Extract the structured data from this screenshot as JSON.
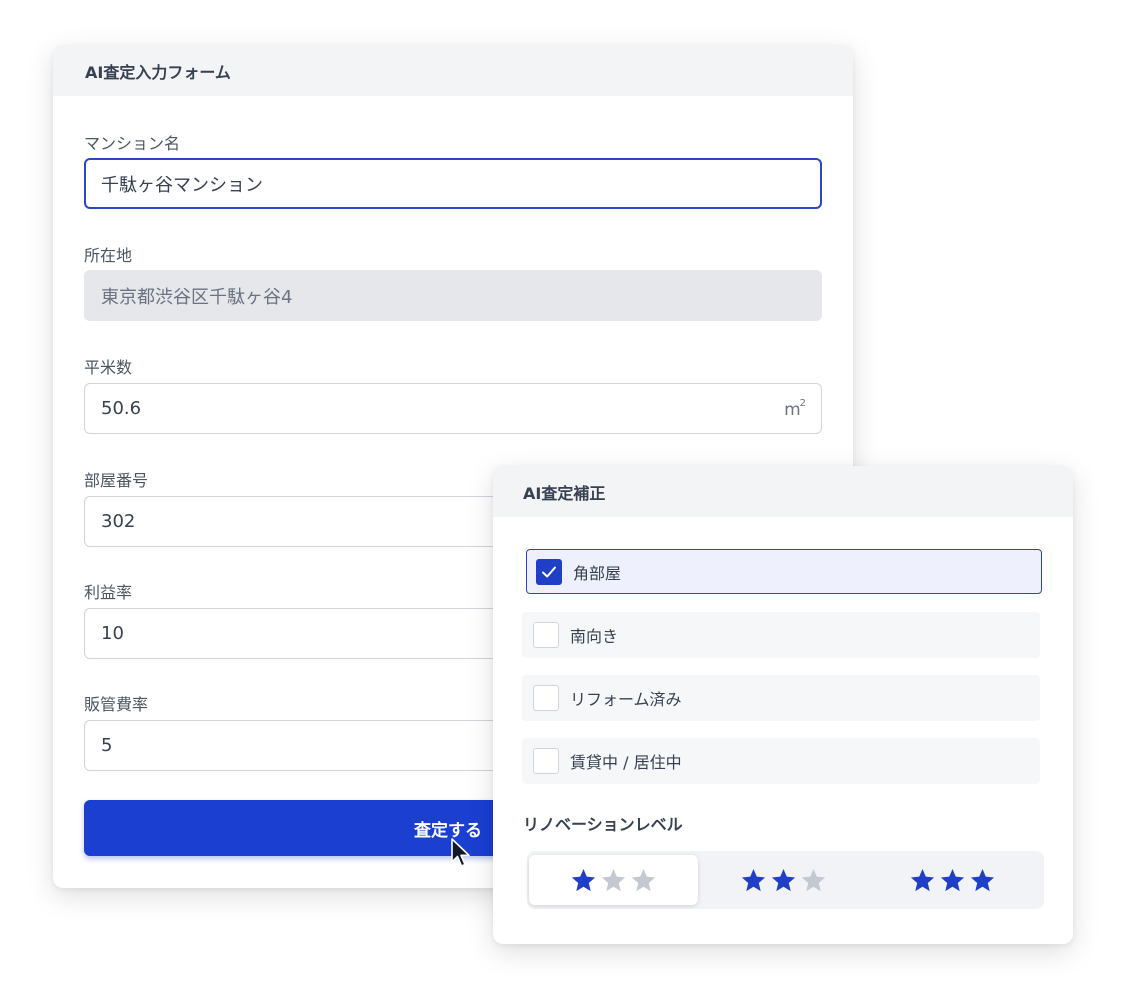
{
  "form": {
    "title": "AI査定入力フォーム",
    "fields": [
      {
        "label": "マンション名",
        "value": "千駄ヶ谷マンション"
      },
      {
        "label": "所在地",
        "value": "東京都渋谷区千駄ヶ谷4"
      },
      {
        "label": "平米数",
        "value": "50.6",
        "unit": "m",
        "unit_sup": "2"
      },
      {
        "label": "部屋番号",
        "value": "302"
      },
      {
        "label": "利益率",
        "value": "10"
      },
      {
        "label": "販管費率",
        "value": "5"
      }
    ],
    "submit_label": "査定する"
  },
  "correction": {
    "title": "AI査定補正",
    "options": [
      {
        "label": "角部屋",
        "checked": true
      },
      {
        "label": "南向き",
        "checked": false
      },
      {
        "label": "リフォーム済み",
        "checked": false
      },
      {
        "label": "賃貸中 / 居住中",
        "checked": false
      }
    ],
    "renovation": {
      "label": "リノベーションレベル",
      "levels": [
        {
          "stars": 1,
          "max": 3,
          "selected": true
        },
        {
          "stars": 2,
          "max": 3,
          "selected": false
        },
        {
          "stars": 3,
          "max": 3,
          "selected": false
        }
      ]
    }
  },
  "colors": {
    "accent": "#1a3fd1",
    "star_filled": "#1f3fc7",
    "star_empty": "#c3c8d1"
  },
  "icons": {
    "check": "check-icon",
    "star": "star-icon",
    "cursor": "mouse-cursor-icon"
  }
}
